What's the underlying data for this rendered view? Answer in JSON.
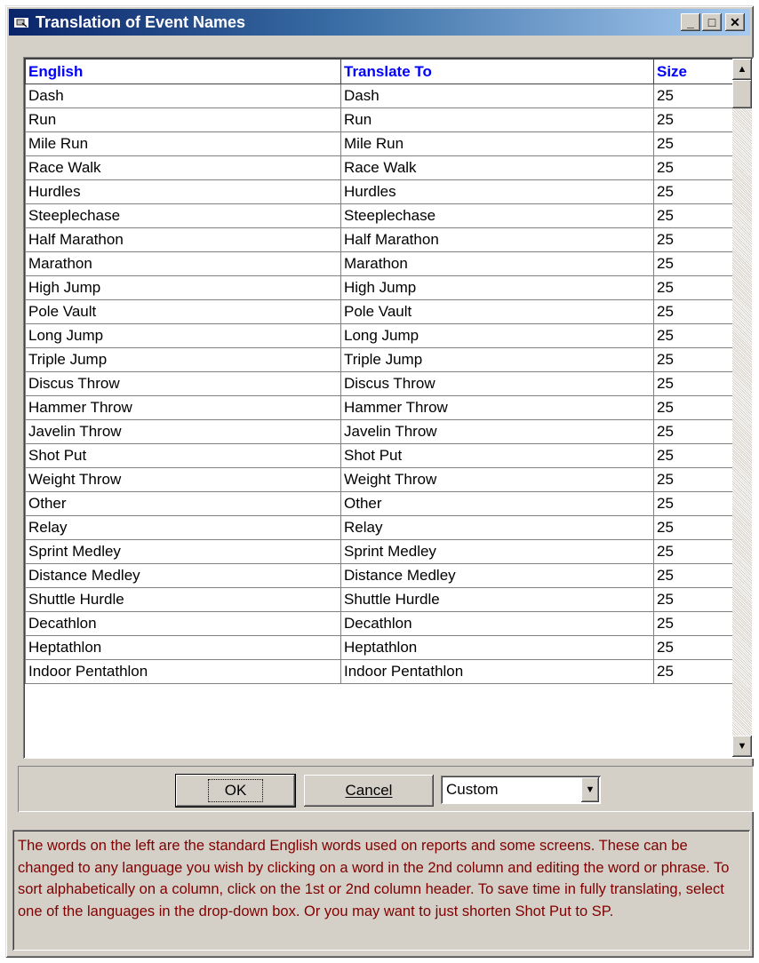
{
  "window": {
    "title": "Translation of Event Names",
    "controls": {
      "minimize": "_",
      "maximize": "□",
      "close": "✕"
    }
  },
  "grid": {
    "columns": [
      "English",
      "Translate To",
      "Size"
    ],
    "rows": [
      [
        "Dash",
        "Dash",
        "25"
      ],
      [
        "Run",
        "Run",
        "25"
      ],
      [
        "Mile Run",
        "Mile Run",
        "25"
      ],
      [
        "Race Walk",
        "Race Walk",
        "25"
      ],
      [
        "Hurdles",
        "Hurdles",
        "25"
      ],
      [
        "Steeplechase",
        "Steeplechase",
        "25"
      ],
      [
        "Half Marathon",
        "Half Marathon",
        "25"
      ],
      [
        "Marathon",
        "Marathon",
        "25"
      ],
      [
        "High Jump",
        "High Jump",
        "25"
      ],
      [
        "Pole Vault",
        "Pole Vault",
        "25"
      ],
      [
        "Long Jump",
        "Long Jump",
        "25"
      ],
      [
        "Triple Jump",
        "Triple Jump",
        "25"
      ],
      [
        "Discus Throw",
        "Discus Throw",
        "25"
      ],
      [
        "Hammer Throw",
        "Hammer Throw",
        "25"
      ],
      [
        "Javelin Throw",
        "Javelin Throw",
        "25"
      ],
      [
        "Shot Put",
        "Shot Put",
        "25"
      ],
      [
        "Weight Throw",
        "Weight Throw",
        "25"
      ],
      [
        "Other",
        "Other",
        "25"
      ],
      [
        "Relay",
        "Relay",
        "25"
      ],
      [
        "Sprint Medley",
        "Sprint Medley",
        "25"
      ],
      [
        "Distance Medley",
        "Distance Medley",
        "25"
      ],
      [
        "Shuttle Hurdle",
        "Shuttle Hurdle",
        "25"
      ],
      [
        "Decathlon",
        "Decathlon",
        "25"
      ],
      [
        "Heptathlon",
        "Heptathlon",
        "25"
      ],
      [
        "Indoor Pentathlon",
        "Indoor Pentathlon",
        "25"
      ]
    ]
  },
  "scrollbar": {
    "up": "▲",
    "down": "▼"
  },
  "buttons": {
    "ok": "OK",
    "cancel": "Cancel"
  },
  "language_select": {
    "value": "Custom",
    "arrow": "▼"
  },
  "help_text": "The words on the left are the standard English words used on reports and some screens. These can be changed to any language you wish by clicking on a word in the 2nd column and editing the word or phrase. To sort alphabetically on a column, click on the 1st or 2nd column header. To save time in fully translating, select one of the languages in the drop-down box. Or you may want to just shorten Shot Put to SP.",
  "colors": {
    "title_start": "#0a246a",
    "title_end": "#a6caf0",
    "header_text": "#0000ff",
    "help_text": "#800000",
    "face": "#d4d0c8"
  }
}
